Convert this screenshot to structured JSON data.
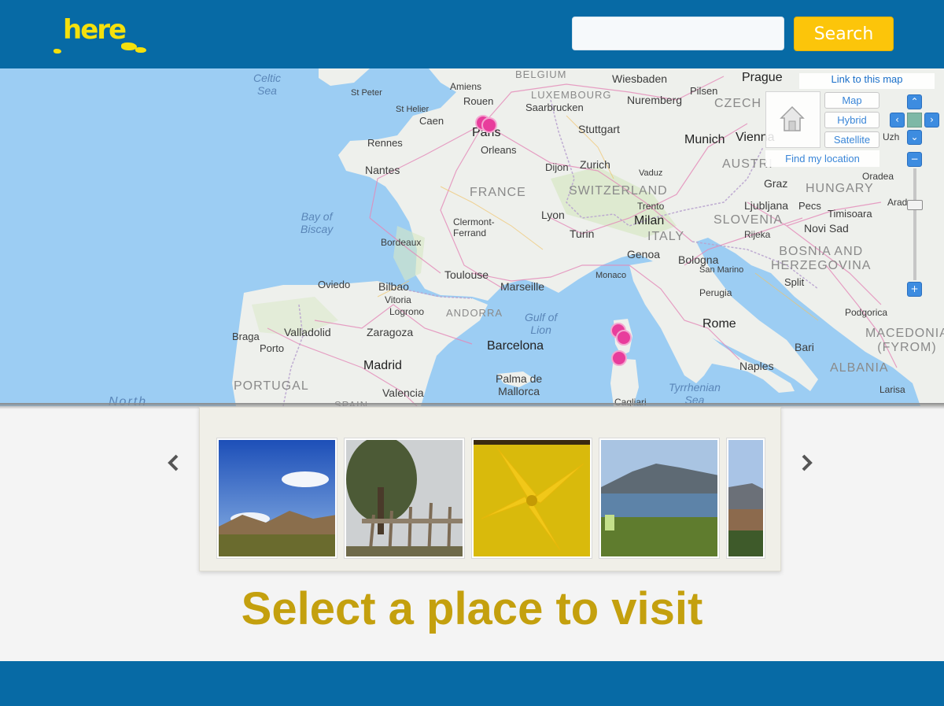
{
  "header": {
    "logo_text": "here",
    "search_placeholder": "",
    "search_button_label": "Search"
  },
  "map": {
    "link_label": "Link to this map",
    "types": [
      "Map",
      "Hybrid",
      "Satellite"
    ],
    "find_location_label": "Find my location",
    "labels": {
      "celtic_sea": "Celtic\nSea",
      "bay_of_biscay": "Bay of\nBiscay",
      "gulf_of_lion": "Gulf of\nLion",
      "tyrrhenian_sea": "Tyrrhenian\nSea",
      "north": "North",
      "france": "FRANCE",
      "switzerland": "SWITZERLAND",
      "italy": "ITALY",
      "portugal": "PORTUGAL",
      "andorra": "ANDORRA",
      "hungary": "HUNGARY",
      "slovenia": "SLOVENIA",
      "bosnia": "BOSNIA AND\nHERZEGOVINA",
      "austria": "AUSTRI",
      "czech": "CZECH",
      "albania": "ALBANIA",
      "macedonia": "MACEDONIA\n(FYROM)",
      "luxembourg": "LUXEMBOURG",
      "belgium": "BELGIUM",
      "paris": "Paris",
      "madrid": "Madrid",
      "rome": "Rome",
      "barcelona": "Barcelona",
      "milan": "Milan",
      "munich": "Munich",
      "zurich": "Zurich",
      "lyon": "Lyon",
      "marseille": "Marseille",
      "toulouse": "Toulouse",
      "bordeaux": "Bordeaux",
      "nantes": "Nantes",
      "rennes": "Rennes",
      "rouen": "Rouen",
      "amiens": "Amiens",
      "caen": "Caen",
      "orleans": "Orleans",
      "dijon": "Dijon",
      "clermont": "Clermont-\nFerrand",
      "genoa": "Genoa",
      "turin": "Turin",
      "bologna": "Bologna",
      "bilbao": "Bilbao",
      "zaragoza": "Zaragoza",
      "valencia": "Valencia",
      "valladolid": "Valladolid",
      "oviedo": "Oviedo",
      "braga": "Braga",
      "porto": "Porto",
      "vitoria": "Vitoria",
      "logrono": "Logrono",
      "palma": "Palma de\nMallorca",
      "naples": "Naples",
      "bari": "Bari",
      "split": "Split",
      "ljubljana": "Ljubljana",
      "graz": "Graz",
      "vienna": "Vienna",
      "stuttgart": "Stuttgart",
      "nuremberg": "Nuremberg",
      "wiesbaden": "Wiesbaden",
      "prague": "Prague",
      "saarbrucken": "Saarbrucken",
      "novi_sad": "Novi Sad",
      "timisoara": "Timisoara",
      "pecs": "Pecs",
      "rijeka": "Rijeka",
      "monaco": "Monaco",
      "trento": "Trento",
      "vaduz": "Vaduz",
      "perugia": "Perugia",
      "san_marino": "San Marino",
      "cagliari": "Cagliari",
      "podgorica": "Podgorica",
      "larisa": "Larisa",
      "oradea": "Oradea",
      "pilsen": "Pilsen",
      "st_peter": "St Peter",
      "st_helier": "St Helier",
      "arad": "Arad",
      "spain": "SPAIN",
      "uzh": "Uzh"
    }
  },
  "carousel": {
    "photos": [
      {
        "name": "mountain-plain-photo"
      },
      {
        "name": "wooden-fence-photo"
      },
      {
        "name": "yellow-flower-photo"
      },
      {
        "name": "lake-mountain-photo"
      },
      {
        "name": "hills-photo"
      }
    ]
  },
  "tagline": "Select a place to visit",
  "colors": {
    "brand_blue": "#076aa5",
    "search_yellow": "#fcc50a",
    "tagline_gold": "#c4a00e",
    "marker_pink": "#e83d9c"
  }
}
